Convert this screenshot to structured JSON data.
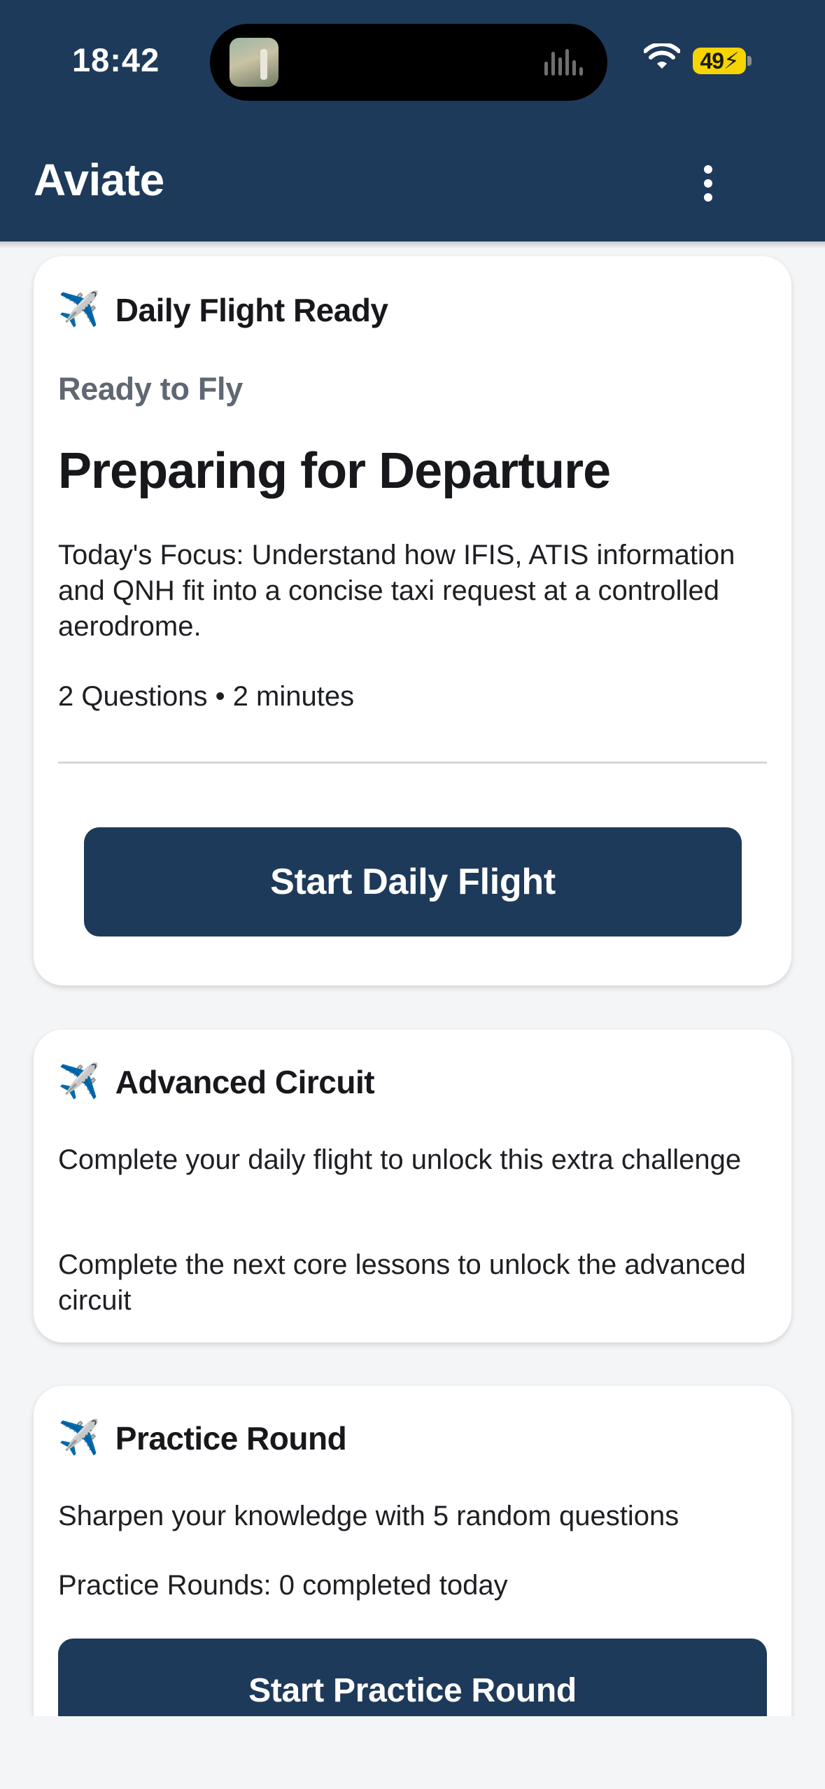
{
  "status_bar": {
    "time": "18:42",
    "battery": "49",
    "icons": [
      "now-playing-thumbnail-icon",
      "audio-waveform-icon",
      "wifi-icon",
      "battery-charging-icon"
    ]
  },
  "app_bar": {
    "title": "Aviate",
    "menu_icon": "more-vertical-icon"
  },
  "colors": {
    "primary": "#1e3a5a",
    "background": "#f4f5f7",
    "card": "#ffffff",
    "muted_text": "#5f6772",
    "battery": "#f5d400"
  },
  "daily_flight": {
    "icon": "✈️",
    "title": "Daily Flight Ready",
    "status_label": "Ready to Fly",
    "headline": "Preparing for Departure",
    "focus": "Today's Focus: Understand how IFIS, ATIS information and QNH fit into a concise taxi request at a controlled aerodrome.",
    "meta": "2  Questions  • 2 minutes",
    "button_label": "Start Daily Flight"
  },
  "advanced_circuit": {
    "icon": "✈️",
    "title": "Advanced Circuit",
    "line1": "Complete your daily flight to unlock this extra challenge",
    "line2": "Complete the next core lessons to unlock the advanced circuit"
  },
  "practice_round": {
    "icon": "✈️",
    "title": "Practice Round",
    "description": "Sharpen your knowledge with 5 random questions",
    "progress": "Practice Rounds: 0 completed today",
    "button_label": "Start Practice Round"
  }
}
